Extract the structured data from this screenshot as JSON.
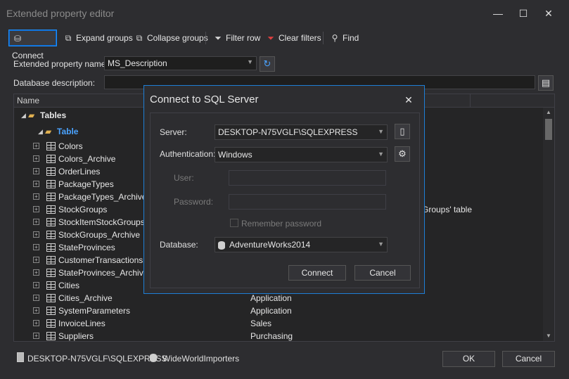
{
  "window": {
    "title": "Extended property editor",
    "minimize": "—",
    "maximize": "☐",
    "close": "✕"
  },
  "toolbar": {
    "connect": "Connect",
    "expand_groups": "Expand groups",
    "collapse_groups": "Collapse groups",
    "filter_row": "Filter row",
    "clear_filters": "Clear filters",
    "find": "Find"
  },
  "form": {
    "ext_prop_label": "Extended property name:",
    "ext_prop_value": "MS_Description",
    "db_desc_label": "Database description:",
    "db_desc_value": ""
  },
  "grid": {
    "columns": [
      "Name",
      "",
      ""
    ],
    "group": "Tables",
    "subgroup": "Table",
    "rows": [
      {
        "name": "Colors",
        "schema": ""
      },
      {
        "name": "Colors_Archive",
        "schema": ""
      },
      {
        "name": "OrderLines",
        "schema": ""
      },
      {
        "name": "PackageTypes",
        "schema": ""
      },
      {
        "name": "PackageTypes_Archive",
        "schema": ""
      },
      {
        "name": "StockGroups",
        "schema": ""
      },
      {
        "name": "StockItemStockGroups",
        "schema": ""
      },
      {
        "name": "StockGroups_Archive",
        "schema": ""
      },
      {
        "name": "StateProvinces",
        "schema": ""
      },
      {
        "name": "CustomerTransactions",
        "schema": ""
      },
      {
        "name": "StateProvinces_Archive",
        "schema": ""
      },
      {
        "name": "Cities",
        "schema": ""
      },
      {
        "name": "Cities_Archive",
        "schema": "Application"
      },
      {
        "name": "SystemParameters",
        "schema": "Application"
      },
      {
        "name": "InvoiceLines",
        "schema": "Sales"
      },
      {
        "name": "Suppliers",
        "schema": "Purchasing"
      }
    ],
    "visible_fragment": "Groups' table"
  },
  "footer": {
    "server": "DESKTOP-N75VGLF\\SQLEXPRESS",
    "database": "WideWorldImporters",
    "ok": "OK",
    "cancel": "Cancel"
  },
  "dialog": {
    "title": "Connect to SQL Server",
    "server_label": "Server:",
    "server_value": "DESKTOP-N75VGLF\\SQLEXPRESS",
    "auth_label": "Authentication:",
    "auth_value": "Windows",
    "user_label": "User:",
    "password_label": "Password:",
    "remember_label": "Remember password",
    "database_label": "Database:",
    "database_value": "AdventureWorks2014",
    "connect": "Connect",
    "cancel": "Cancel"
  },
  "colors": {
    "accent": "#1e90ff",
    "background": "#2d2d30",
    "group_link": "#4aa3ff"
  }
}
